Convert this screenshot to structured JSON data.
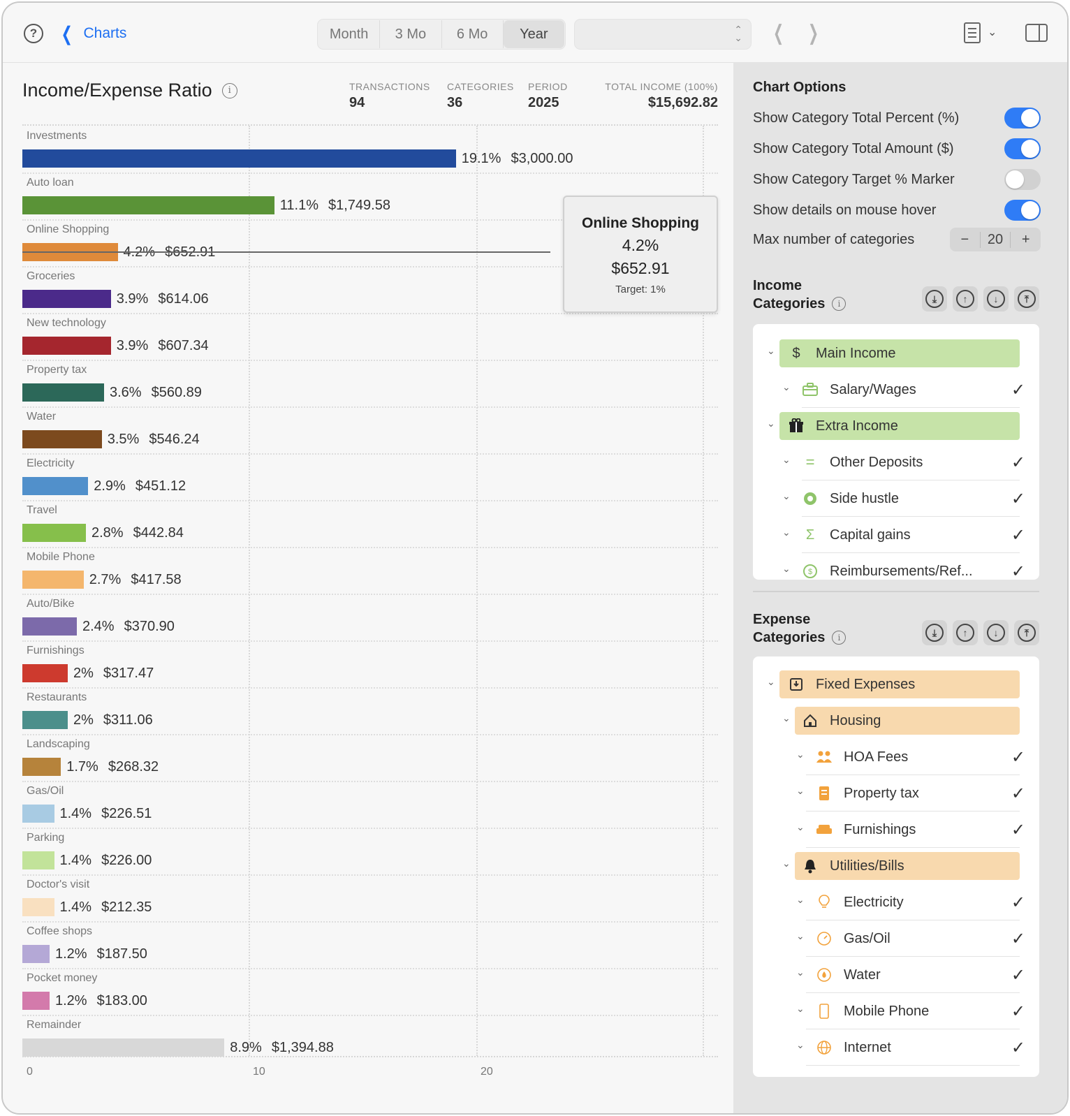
{
  "toolbar": {
    "help_label": "?",
    "back_label": "Charts",
    "segments": [
      "Month",
      "3 Mo",
      "6 Mo",
      "Year"
    ],
    "active_segment": "Year",
    "period_select_value": ""
  },
  "chart": {
    "title": "Income/Expense Ratio",
    "stats": [
      {
        "label": "TRANSACTIONS",
        "value": "94"
      },
      {
        "label": "CATEGORIES",
        "value": "36"
      },
      {
        "label": "PERIOD",
        "value": "2025"
      },
      {
        "label": "TOTAL INCOME (100%)",
        "value": "$15,692.82"
      }
    ],
    "tooltip": {
      "name": "Online Shopping",
      "percent": "4.2%",
      "amount": "$652.91",
      "target": "Target: 1%"
    }
  },
  "chart_data": {
    "type": "bar",
    "orientation": "horizontal",
    "title": "Income/Expense Ratio",
    "xlim": [
      0,
      30
    ],
    "x_ticks": [
      "0",
      "10",
      "20"
    ],
    "grid": true,
    "categories": [
      "Investments",
      "Auto loan",
      "Online Shopping",
      "Groceries",
      "New technology",
      "Property tax",
      "Water",
      "Electricity",
      "Travel",
      "Mobile Phone",
      "Auto/Bike",
      "Furnishings",
      "Restaurants",
      "Landscaping",
      "Gas/Oil",
      "Parking",
      "Doctor's visit",
      "Coffee shops",
      "Pocket money",
      "Remainder"
    ],
    "values": [
      19.1,
      11.1,
      4.2,
      3.9,
      3.9,
      3.6,
      3.5,
      2.9,
      2.8,
      2.7,
      2.4,
      2.0,
      2.0,
      1.7,
      1.4,
      1.4,
      1.4,
      1.2,
      1.2,
      8.9
    ],
    "percent_labels": [
      "19.1%",
      "11.1%",
      "4.2%",
      "3.9%",
      "3.9%",
      "3.6%",
      "3.5%",
      "2.9%",
      "2.8%",
      "2.7%",
      "2.4%",
      "2%",
      "2%",
      "1.7%",
      "1.4%",
      "1.4%",
      "1.4%",
      "1.2%",
      "1.2%",
      "8.9%"
    ],
    "amounts": [
      "$3,000.00",
      "$1,749.58",
      "$652.91",
      "$614.06",
      "$607.34",
      "$560.89",
      "$546.24",
      "$451.12",
      "$442.84",
      "$417.58",
      "$370.90",
      "$317.47",
      "$311.06",
      "$268.32",
      "$226.51",
      "$226.00",
      "$212.35",
      "$187.50",
      "$183.00",
      "$1,394.88"
    ],
    "colors": [
      "#224b9c",
      "#5a9337",
      "#df8a3a",
      "#4b2a8a",
      "#a5262e",
      "#2c6859",
      "#7c4a1e",
      "#5190cb",
      "#86bf4b",
      "#f4b66d",
      "#7c6aaa",
      "#cd3a2e",
      "#4b8f8b",
      "#b6833b",
      "#a8cbe3",
      "#c2e39a",
      "#f9e0c0",
      "#b4a8d6",
      "#d37aab",
      "#d8d8d8"
    ]
  },
  "options": {
    "title": "Chart Options",
    "toggles": [
      {
        "label": "Show Category Total Percent (%)",
        "on": true
      },
      {
        "label": "Show Category Total Amount ($)",
        "on": true
      },
      {
        "label": "Show Category Target % Marker",
        "on": false
      },
      {
        "label": "Show details on mouse hover",
        "on": true
      }
    ],
    "max_categories_label": "Max number of categories",
    "max_categories_value": "20",
    "minus": "−",
    "plus": "+"
  },
  "income": {
    "heading_line1": "Income",
    "heading_line2": "Categories",
    "items": [
      {
        "label": "Main Income",
        "icon": "$",
        "level": 0,
        "group": true
      },
      {
        "label": "Salary/Wages",
        "icon": "briefcase",
        "level": 1,
        "checked": true
      },
      {
        "label": "Extra Income",
        "icon": "gift",
        "level": 0,
        "group": true
      },
      {
        "label": "Other Deposits",
        "icon": "=",
        "level": 1,
        "checked": true
      },
      {
        "label": "Side hustle",
        "icon": "lifebuoy",
        "level": 1,
        "checked": true
      },
      {
        "label": "Capital gains",
        "icon": "Σ",
        "level": 1,
        "checked": true
      },
      {
        "label": "Reimbursements/Ref...",
        "icon": "$",
        "level": 1,
        "checked": true
      }
    ]
  },
  "expense": {
    "heading_line1": "Expense",
    "heading_line2": "Categories",
    "items": [
      {
        "label": "Fixed Expenses",
        "level": 0,
        "group": true
      },
      {
        "label": "Housing",
        "level": 1,
        "group": true
      },
      {
        "label": "HOA Fees",
        "level": 2,
        "checked": true
      },
      {
        "label": "Property tax",
        "level": 2,
        "checked": true
      },
      {
        "label": "Furnishings",
        "level": 2,
        "checked": true
      },
      {
        "label": "Utilities/Bills",
        "level": 1,
        "group": true
      },
      {
        "label": "Electricity",
        "level": 2,
        "checked": true
      },
      {
        "label": "Gas/Oil",
        "level": 2,
        "checked": true
      },
      {
        "label": "Water",
        "level": 2,
        "checked": true
      },
      {
        "label": "Mobile Phone",
        "level": 2,
        "checked": true
      },
      {
        "label": "Internet",
        "level": 2,
        "checked": true
      }
    ]
  }
}
